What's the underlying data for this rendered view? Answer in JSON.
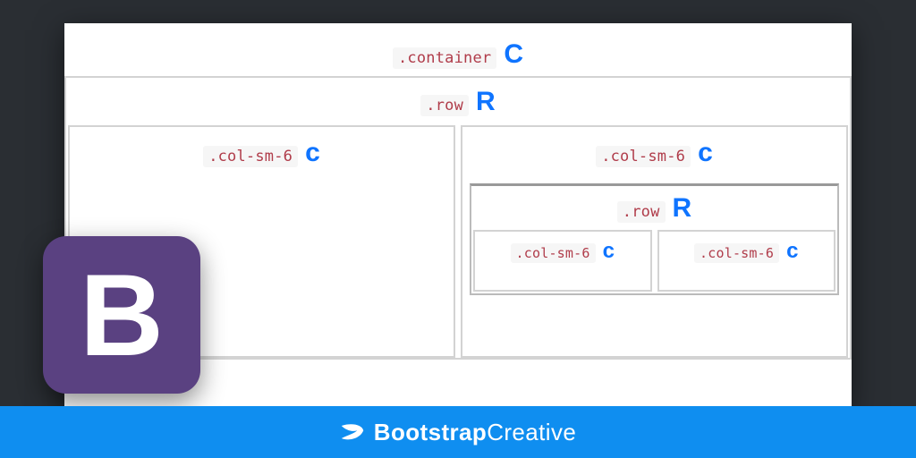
{
  "diagram": {
    "container": {
      "class": ".container",
      "letter": "C"
    },
    "row": {
      "class": ".row",
      "letter": "R"
    },
    "cols": [
      {
        "class": ".col-sm-6",
        "letter": "c"
      },
      {
        "class": ".col-sm-6",
        "letter": "c"
      }
    ],
    "nested": {
      "row": {
        "class": ".row",
        "letter": "R"
      },
      "cols": [
        {
          "class": ".col-sm-6",
          "letter": "c"
        },
        {
          "class": ".col-sm-6",
          "letter": "c"
        }
      ]
    }
  },
  "logo": {
    "letter": "B"
  },
  "footer": {
    "brand_bold": "Bootstrap",
    "brand_rest": "Creative"
  },
  "colors": {
    "accent_blue": "#0f74ff",
    "code_red": "#b03c4a",
    "footer_bg": "#0f8ef0",
    "logo_bg": "#5a4181"
  }
}
